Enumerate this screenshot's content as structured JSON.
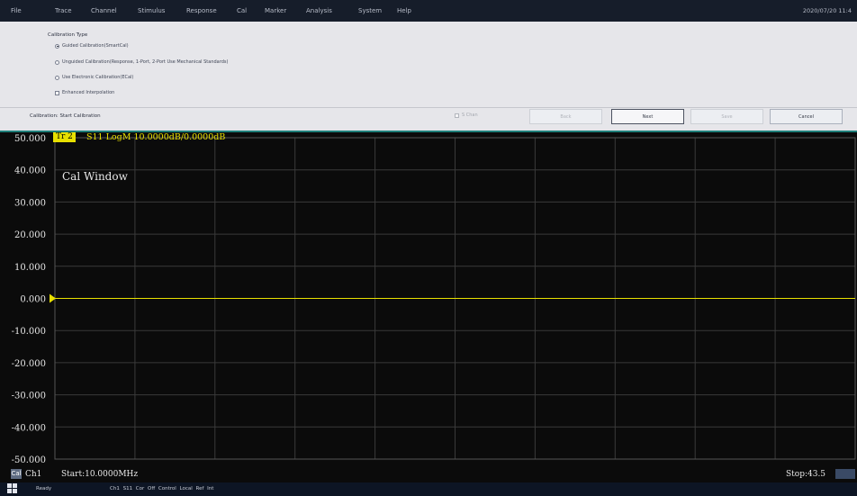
{
  "menu": [
    "File",
    "Trace",
    "Channel",
    "Stimulus",
    "Response",
    "Cal",
    "Marker",
    "Analysis",
    "System",
    "Help"
  ],
  "datetime": "2020/07/20 11:4",
  "calibration": {
    "group_title": "Calibration Type",
    "options": [
      "Guided Calibration(SmartCal)",
      "Unguided Calibration(Response, 1-Port, 2-Port Use Mechanical Standards)",
      "Use Electronic Calibration(ECal)",
      "Enhanced Interpolation"
    ],
    "selected_option": 0,
    "section_label": "Calibration: Start Calibration",
    "single_channel_label": "S Chan",
    "buttons": {
      "back": "Back",
      "next": "Next",
      "save": "Save",
      "cancel": "Cancel"
    }
  },
  "trace": {
    "id": "Tr 2",
    "info": "S11 LogM 10.0000dB/0.0000dB",
    "color": "#e8e000"
  },
  "window_label": "Cal Window",
  "chart_data": {
    "type": "line",
    "title": "",
    "xlabel": "",
    "ylabel": "",
    "yticks": [
      "50.000",
      "40.000",
      "30.000",
      "20.000",
      "10.000",
      "0.000",
      "-10.000",
      "-20.000",
      "-30.000",
      "-40.000",
      "-50.000"
    ],
    "ylim": [
      -50,
      50
    ],
    "grid": true,
    "reference_level": 0,
    "series": [
      {
        "values": [
          0,
          0
        ]
      }
    ]
  },
  "channel": {
    "badge": "Cal",
    "label": "Ch1",
    "start": "Start:10.0000MHz",
    "stop": "Stop:43.5"
  },
  "status": {
    "ready": "Ready",
    "fields": "Ch1  S11  Cor Off  Control Local  Ref Int"
  }
}
